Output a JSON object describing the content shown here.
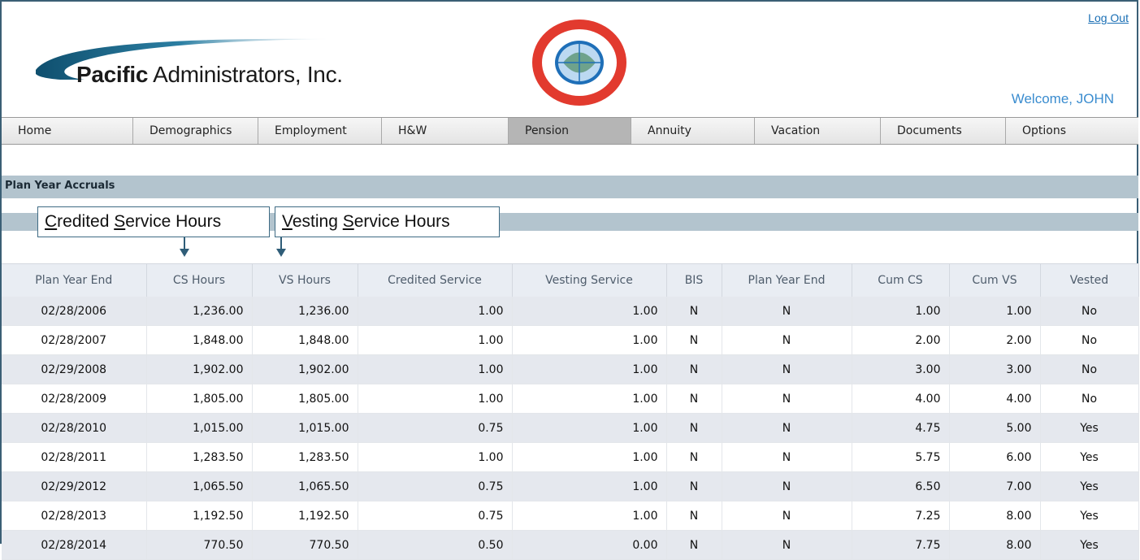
{
  "header": {
    "logo_bold": "Pacific",
    "logo_rest": " Administrators, Inc.",
    "logout_label": "Log Out",
    "welcome_text": "Welcome, JOHN"
  },
  "nav": {
    "items": [
      {
        "label": "Home"
      },
      {
        "label": "Demographics"
      },
      {
        "label": "Employment"
      },
      {
        "label": "H&W"
      },
      {
        "label": "Pension"
      },
      {
        "label": "Annuity"
      },
      {
        "label": "Vacation"
      },
      {
        "label": "Documents"
      },
      {
        "label": "Options"
      }
    ],
    "active": "Pension"
  },
  "section": {
    "title": "Plan Year Accruals"
  },
  "callouts": {
    "cs_first": "C",
    "cs_rest1": "redited ",
    "cs_s": "S",
    "cs_rest2": "ervice Hours",
    "vs_first": "V",
    "vs_rest1": "esting ",
    "vs_s": "S",
    "vs_rest2": "ervice Hours"
  },
  "table": {
    "headers": [
      "Plan Year End",
      "CS Hours",
      "VS Hours",
      "Credited Service",
      "Vesting Service",
      "BIS",
      "Plan Year End",
      "Cum CS",
      "Cum VS",
      "Vested"
    ],
    "rows": [
      [
        "02/28/2006",
        "1,236.00",
        "1,236.00",
        "1.00",
        "1.00",
        "N",
        "N",
        "1.00",
        "1.00",
        "No"
      ],
      [
        "02/28/2007",
        "1,848.00",
        "1,848.00",
        "1.00",
        "1.00",
        "N",
        "N",
        "2.00",
        "2.00",
        "No"
      ],
      [
        "02/29/2008",
        "1,902.00",
        "1,902.00",
        "1.00",
        "1.00",
        "N",
        "N",
        "3.00",
        "3.00",
        "No"
      ],
      [
        "02/28/2009",
        "1,805.00",
        "1,805.00",
        "1.00",
        "1.00",
        "N",
        "N",
        "4.00",
        "4.00",
        "No"
      ],
      [
        "02/28/2010",
        "1,015.00",
        "1,015.00",
        "0.75",
        "1.00",
        "N",
        "N",
        "4.75",
        "5.00",
        "Yes"
      ],
      [
        "02/28/2011",
        "1,283.50",
        "1,283.50",
        "1.00",
        "1.00",
        "N",
        "N",
        "5.75",
        "6.00",
        "Yes"
      ],
      [
        "02/29/2012",
        "1,065.50",
        "1,065.50",
        "0.75",
        "1.00",
        "N",
        "N",
        "6.50",
        "7.00",
        "Yes"
      ],
      [
        "02/28/2013",
        "1,192.50",
        "1,192.50",
        "0.75",
        "1.00",
        "N",
        "N",
        "7.25",
        "8.00",
        "Yes"
      ],
      [
        "02/28/2014",
        "770.50",
        "770.50",
        "0.50",
        "0.00",
        "N",
        "N",
        "7.75",
        "8.00",
        "Yes"
      ]
    ]
  },
  "colors": {
    "section_bar": "#b3c4ce",
    "link": "#1a6fb5",
    "welcome": "#3a8ccf",
    "active_tab": "#b5b5b5"
  }
}
